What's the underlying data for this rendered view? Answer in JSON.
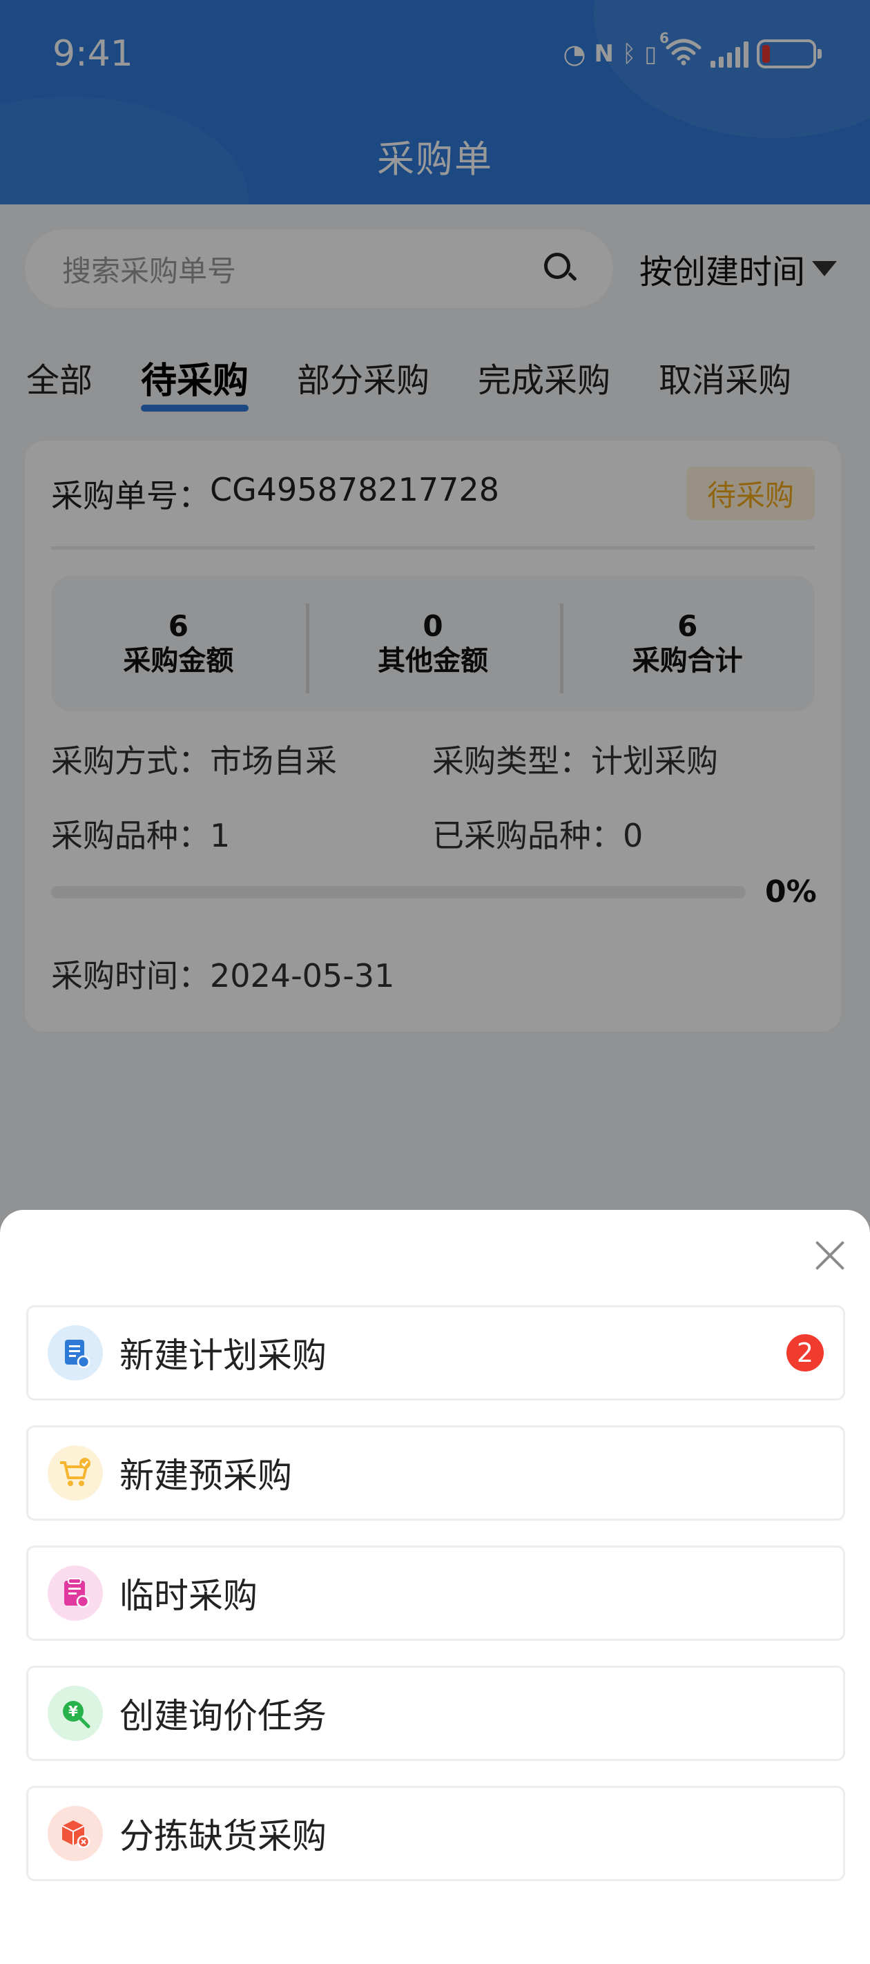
{
  "status_bar": {
    "time": "9:41",
    "network": "6",
    "battery_level": 0.15,
    "icons": [
      "speed-icon",
      "nfc-icon",
      "bluetooth-icon",
      "vibrate-icon",
      "wifi-icon",
      "signal-icon",
      "battery-icon"
    ]
  },
  "header": {
    "title": "采购单",
    "color": "#2f7ad7"
  },
  "search": {
    "placeholder": "搜索采购单号"
  },
  "sort": {
    "label": "按创建时间"
  },
  "tabs": [
    {
      "label": "全部",
      "active": false
    },
    {
      "label": "待采购",
      "active": true
    },
    {
      "label": "部分采购",
      "active": false
    },
    {
      "label": "完成采购",
      "active": false
    },
    {
      "label": "取消采购",
      "active": false
    }
  ],
  "order": {
    "number_label": "采购单号：",
    "number": "CG495878217728",
    "status": "待采购",
    "amounts": [
      {
        "value": "6",
        "label": "采购金额"
      },
      {
        "value": "0",
        "label": "其他金额"
      },
      {
        "value": "6",
        "label": "采购合计"
      }
    ],
    "method": "采购方式：市场自采",
    "type": "采购类型：计划采购",
    "varieties": "采购品种：1",
    "purchased_varieties": "已采购品种：0",
    "progress_text": "0%",
    "progress_value": 0,
    "time": "采购时间：2024-05-31"
  },
  "sheet": {
    "items": [
      {
        "label": "新建计划采购",
        "icon": "plan-purchase-icon",
        "icon_bg": "#dcecfb",
        "icon_color": "#2f7ad7",
        "badge": "2"
      },
      {
        "label": "新建预采购",
        "icon": "cart-icon",
        "icon_bg": "#fdf1d6",
        "icon_color": "#f5b531"
      },
      {
        "label": "临时采购",
        "icon": "temporary-purchase-icon",
        "icon_bg": "#fbdcef",
        "icon_color": "#e03aa0"
      },
      {
        "label": "创建询价任务",
        "icon": "inquiry-icon",
        "icon_bg": "#dcf5e2",
        "icon_color": "#28b24b"
      },
      {
        "label": "分拣缺货采购",
        "icon": "stockout-box-icon",
        "icon_bg": "#fde2dc",
        "icon_color": "#f0553c"
      }
    ]
  }
}
